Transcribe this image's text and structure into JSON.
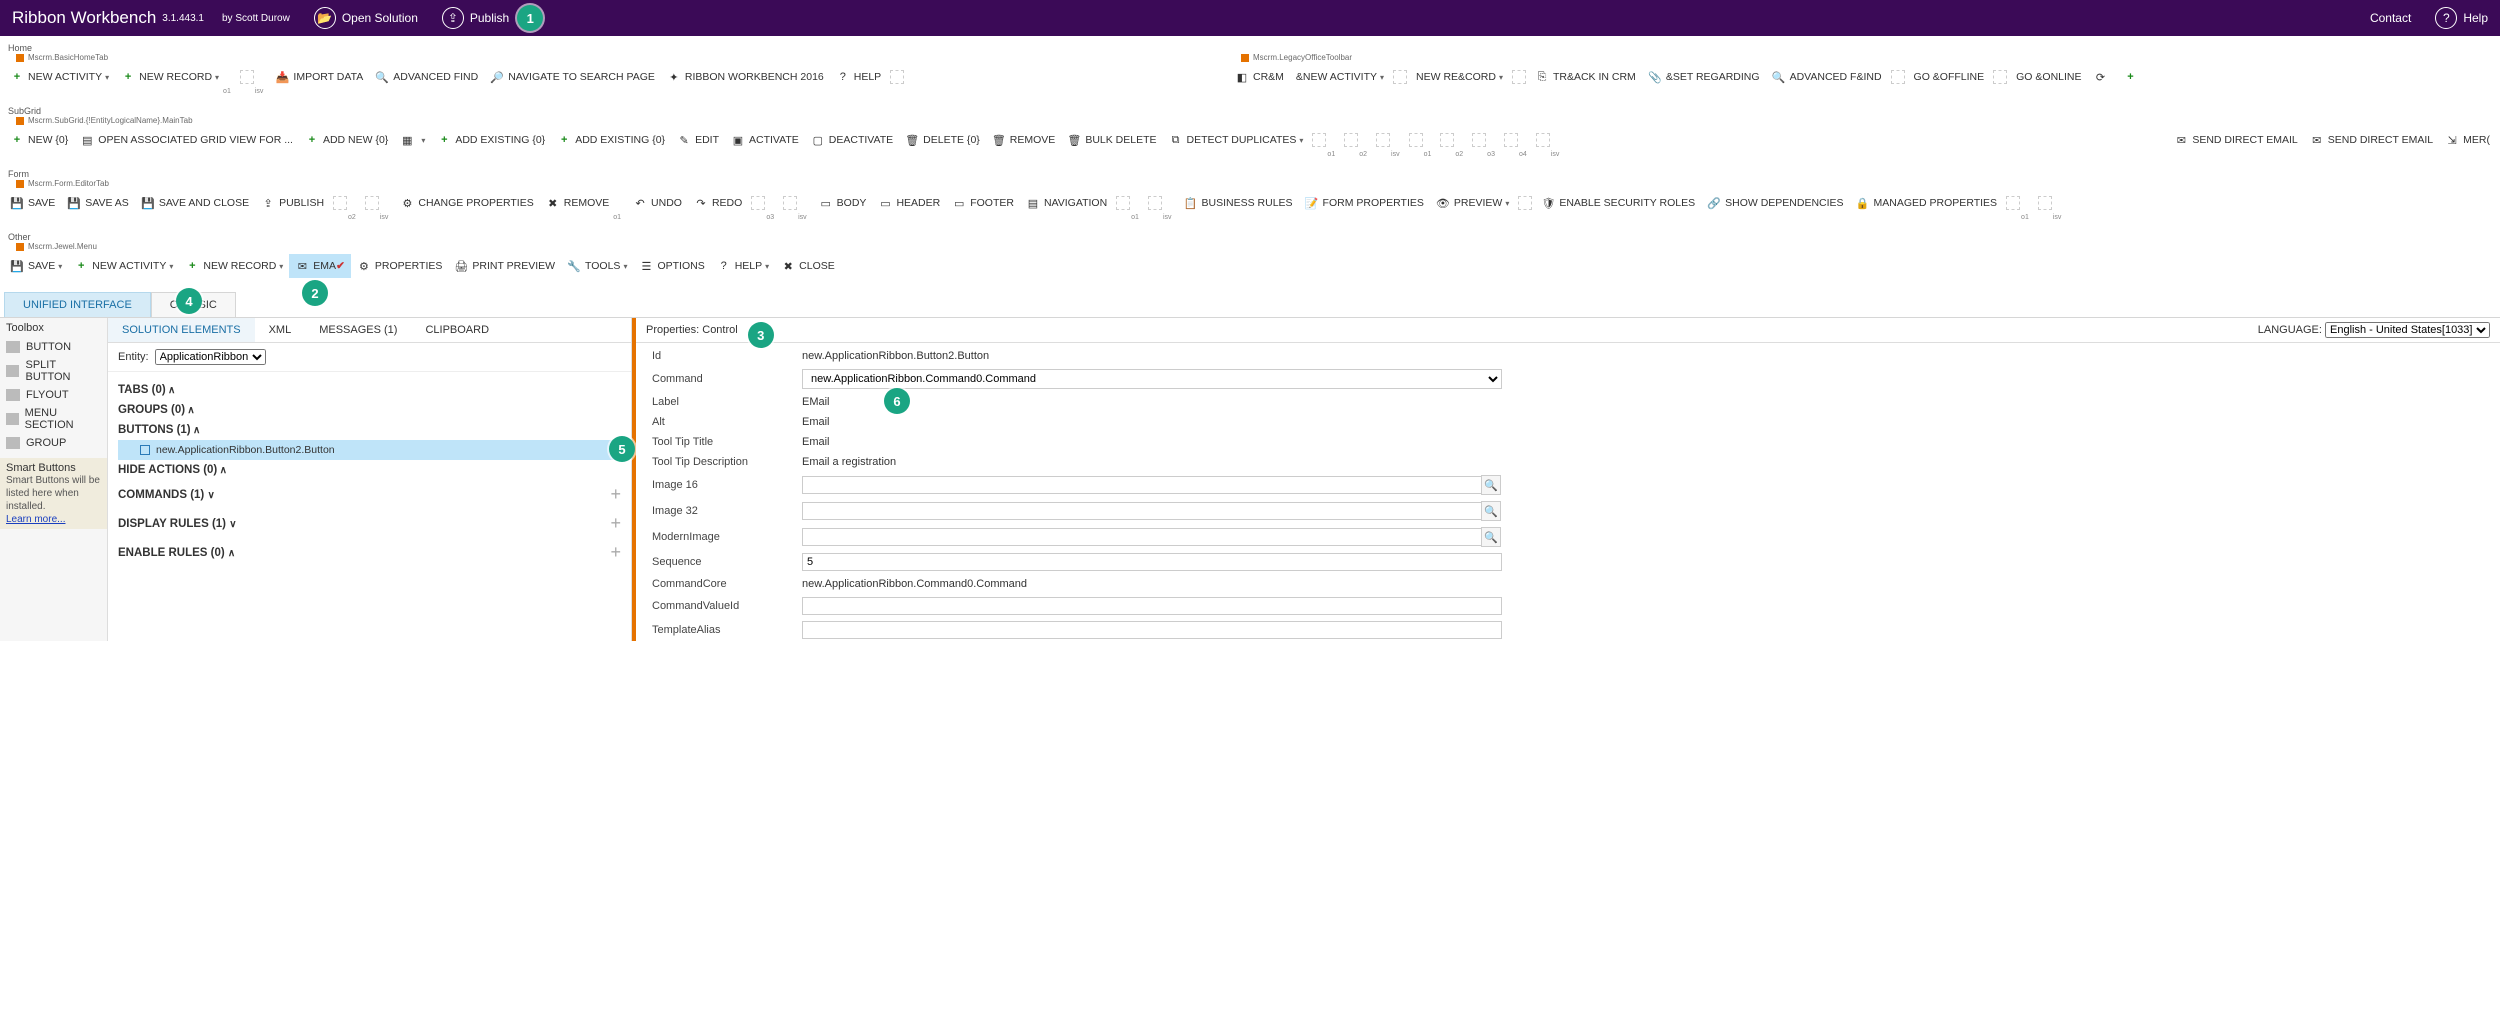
{
  "header": {
    "app_title": "Ribbon Workbench",
    "version": "3.1.443.1",
    "author": "by Scott Durow",
    "open_solution": "Open Solution",
    "publish": "Publish",
    "contact": "Contact",
    "help": "Help"
  },
  "ribbons": {
    "home": {
      "section": "Home",
      "scopeA": "Mscrm.BasicHomeTab",
      "scopeB": "Mscrm.LegacyOfficeToolbar",
      "buttonsA": [
        "NEW ACTIVITY",
        "NEW RECORD",
        "IMPORT DATA",
        "ADVANCED FIND",
        "NAVIGATE TO SEARCH PAGE",
        "RIBBON WORKBENCH 2016",
        "HELP"
      ],
      "buttonsB": [
        "CR&M",
        "&NEW ACTIVITY",
        "NEW RE&CORD",
        "TR&ACK IN CRM",
        "&SET REGARDING",
        "ADVANCED F&IND",
        "GO &OFFLINE",
        "GO &ONLINE"
      ]
    },
    "subgrid": {
      "section": "SubGrid",
      "scope": "Mscrm.SubGrid.{!EntityLogicalName}.MainTab",
      "buttons": [
        "NEW {0}",
        "OPEN ASSOCIATED GRID VIEW FOR ...",
        "ADD NEW {0}",
        "ADD EXISTING {0}",
        "ADD EXISTING {0}",
        "EDIT",
        "ACTIVATE",
        "DEACTIVATE",
        "DELETE {0}",
        "REMOVE",
        "BULK DELETE",
        "DETECT DUPLICATES",
        "SEND DIRECT EMAIL",
        "SEND DIRECT EMAIL",
        "MER("
      ]
    },
    "form": {
      "section": "Form",
      "scope": "Mscrm.Form.EditorTab",
      "buttons": [
        "SAVE",
        "SAVE AS",
        "SAVE AND CLOSE",
        "PUBLISH",
        "CHANGE PROPERTIES",
        "REMOVE",
        "UNDO",
        "REDO",
        "BODY",
        "HEADER",
        "FOOTER",
        "NAVIGATION",
        "BUSINESS RULES",
        "FORM PROPERTIES",
        "PREVIEW",
        "ENABLE SECURITY ROLES",
        "SHOW DEPENDENCIES",
        "MANAGED PROPERTIES"
      ]
    },
    "other": {
      "section": "Other",
      "scope": "Mscrm.Jewel.Menu",
      "buttons": [
        "SAVE",
        "NEW ACTIVITY",
        "NEW RECORD",
        "EMA",
        "PROPERTIES",
        "PRINT PREVIEW",
        "TOOLS",
        "OPTIONS",
        "HELP",
        "CLOSE"
      ]
    }
  },
  "tabs": {
    "unified": "UNIFIED INTERFACE",
    "classic": "CLASSIC"
  },
  "toolbox": {
    "title": "Toolbox",
    "items": [
      "BUTTON",
      "SPLIT BUTTON",
      "FLYOUT",
      "MENU SECTION",
      "GROUP"
    ],
    "smart_title": "Smart Buttons",
    "smart_desc": "Smart Buttons will be listed here when installed.",
    "learn_more": "Learn more..."
  },
  "subtabs": [
    "SOLUTION ELEMENTS",
    "XML",
    "MESSAGES (1)",
    "CLIPBOARD"
  ],
  "entity": {
    "label": "Entity:",
    "value": "ApplicationRibbon"
  },
  "tree": {
    "tabs": "TABS (0)",
    "groups": "GROUPS (0)",
    "buttons": "BUTTONS (1)",
    "button_item": "new.ApplicationRibbon.Button2.Button",
    "hide": "HIDE ACTIONS (0)",
    "commands": "COMMANDS (1)",
    "display": "DISPLAY RULES (1)",
    "enable": "ENABLE RULES (0)"
  },
  "props": {
    "title": "Properties: Control",
    "lang_label": "LANGUAGE:",
    "lang_value": "English - United States[1033]",
    "rows": {
      "Id": "new.ApplicationRibbon.Button2.Button",
      "Command": "new.ApplicationRibbon.Command0.Command",
      "Label": "EMail",
      "Alt": "Email",
      "ToolTipTitle": "Email",
      "ToolTipDescription": "Email a registration",
      "Image16": "",
      "Image32": "",
      "ModernImage": "",
      "Sequence": "5",
      "CommandCore": "new.ApplicationRibbon.Command0.Command",
      "CommandValueId": "",
      "TemplateAlias": ""
    },
    "labels": {
      "Id": "Id",
      "Command": "Command",
      "Label": "Label",
      "Alt": "Alt",
      "ToolTipTitle": "Tool Tip Title",
      "ToolTipDescription": "Tool Tip Description",
      "Image16": "Image 16",
      "Image32": "Image 32",
      "ModernImage": "ModernImage",
      "Sequence": "Sequence",
      "CommandCore": "CommandCore",
      "CommandValueId": "CommandValueId",
      "TemplateAlias": "TemplateAlias"
    }
  },
  "annotations": {
    "1": "1",
    "2": "2",
    "3": "3",
    "4": "4",
    "5": "5",
    "6": "6"
  }
}
